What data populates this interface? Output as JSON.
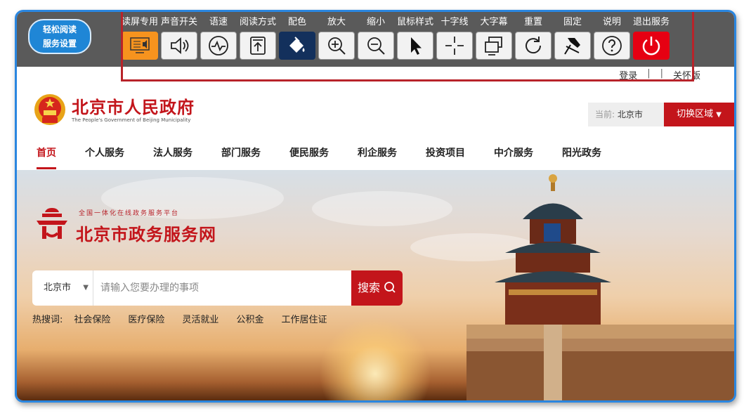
{
  "toolbar": {
    "settings_line1": "轻松阅读",
    "settings_line2": "服务设置",
    "tools": [
      {
        "label": "读屏专用",
        "icon": "screen-reader-icon",
        "style": "orange"
      },
      {
        "label": "声音开关",
        "icon": "speaker-icon"
      },
      {
        "label": "语速",
        "icon": "speech-rate-icon"
      },
      {
        "label": "阅读方式",
        "icon": "reading-mode-icon"
      },
      {
        "label": "配色",
        "icon": "paint-bucket-icon",
        "style": "navy"
      },
      {
        "label": "放大",
        "icon": "zoom-in-icon"
      },
      {
        "label": "缩小",
        "icon": "zoom-out-icon"
      },
      {
        "label": "鼠标样式",
        "icon": "cursor-icon"
      },
      {
        "label": "十字线",
        "icon": "crosshair-icon"
      },
      {
        "label": "大字幕",
        "icon": "caption-icon"
      },
      {
        "label": "重置",
        "icon": "reset-icon"
      },
      {
        "label": "固定",
        "icon": "pin-icon"
      },
      {
        "label": "说明",
        "icon": "help-icon"
      },
      {
        "label": "退出服务",
        "icon": "power-icon",
        "style": "red"
      }
    ]
  },
  "header": {
    "login": "登录",
    "care_version": "关怀版",
    "site_name": "北京市人民政府",
    "site_name_en": "The People's Government of Beijing Municipality",
    "region_prefix": "当前:",
    "region_value": "北京市",
    "switch_region": "切换区域"
  },
  "nav": [
    "首页",
    "个人服务",
    "法人服务",
    "部门服务",
    "便民服务",
    "利企服务",
    "投资项目",
    "中介服务",
    "阳光政务"
  ],
  "hero": {
    "platform_small": "全国一体化在线政务服务平台",
    "platform_name": "北京市政务服务网",
    "city": "北京市",
    "search_placeholder": "请输入您要办理的事项",
    "search_button": "搜索",
    "hot_label": "热搜词:",
    "hot_terms": [
      "社会保险",
      "医疗保险",
      "灵活就业",
      "公积金",
      "工作居住证"
    ]
  },
  "colors": {
    "brand_red": "#c3151b",
    "toolbar_gray": "#5a5a5a",
    "accent_orange": "#f7931e",
    "accent_navy": "#13305c",
    "frame_blue": "#2a86e0"
  }
}
